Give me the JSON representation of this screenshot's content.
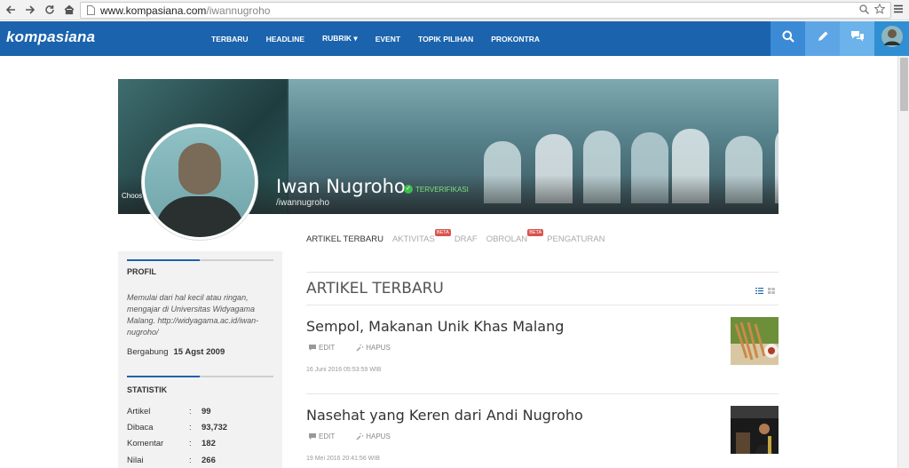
{
  "browser": {
    "url_domain": "www.kompasiana.com",
    "url_path": "/iwannugroho"
  },
  "header": {
    "logo": "kompasiana",
    "nav": [
      "TERBARU",
      "HEADLINE",
      "RUBRIK ▾",
      "EVENT",
      "TOPIK PILIHAN",
      "PROKONTRA"
    ]
  },
  "profile": {
    "name": "Iwan Nugroho",
    "verified": "TERVERIFIKASI",
    "username": "/iwannugroho",
    "cover_hint": "Choos"
  },
  "tabs": [
    {
      "label": "ARTIKEL TERBARU",
      "active": true,
      "beta": ""
    },
    {
      "label": "AKTIVITAS",
      "active": false,
      "beta": "BETA"
    },
    {
      "label": "DRAF",
      "active": false,
      "beta": ""
    },
    {
      "label": "OBROLAN",
      "active": false,
      "beta": "BETA"
    },
    {
      "label": "PENGATURAN",
      "active": false,
      "beta": ""
    }
  ],
  "sidebar": {
    "profil_heading": "PROFIL",
    "bio": "Memulai dari hal kecil atau ringan, mengajar di Universitas Widyagama Malang. http://widyagama.ac.id/iwan-nugroho/",
    "joined_label": "Bergabung",
    "joined_value": "15 Agst 2009",
    "stats_heading": "STATISTIK",
    "stats": [
      {
        "label": "Artikel",
        "value": "99"
      },
      {
        "label": "Dibaca",
        "value": "93,732"
      },
      {
        "label": "Komentar",
        "value": "182"
      },
      {
        "label": "Nilai",
        "value": "266"
      }
    ]
  },
  "main": {
    "section_title": "ARTIKEL TERBARU",
    "edit_label": "EDIT",
    "hapus_label": "HAPUS",
    "articles": [
      {
        "title": "Sempol, Makanan Unik Khas Malang",
        "date": "16 Juni 2016 05:53:59 WIB"
      },
      {
        "title": "Nasehat yang Keren dari Andi Nugroho",
        "date": "19 Mei 2016 20:41:56 WIB"
      }
    ]
  },
  "colors": {
    "brand_blue": "#1b63ad",
    "verified_green": "#3dbf4a",
    "beta_red": "#d9534f"
  }
}
